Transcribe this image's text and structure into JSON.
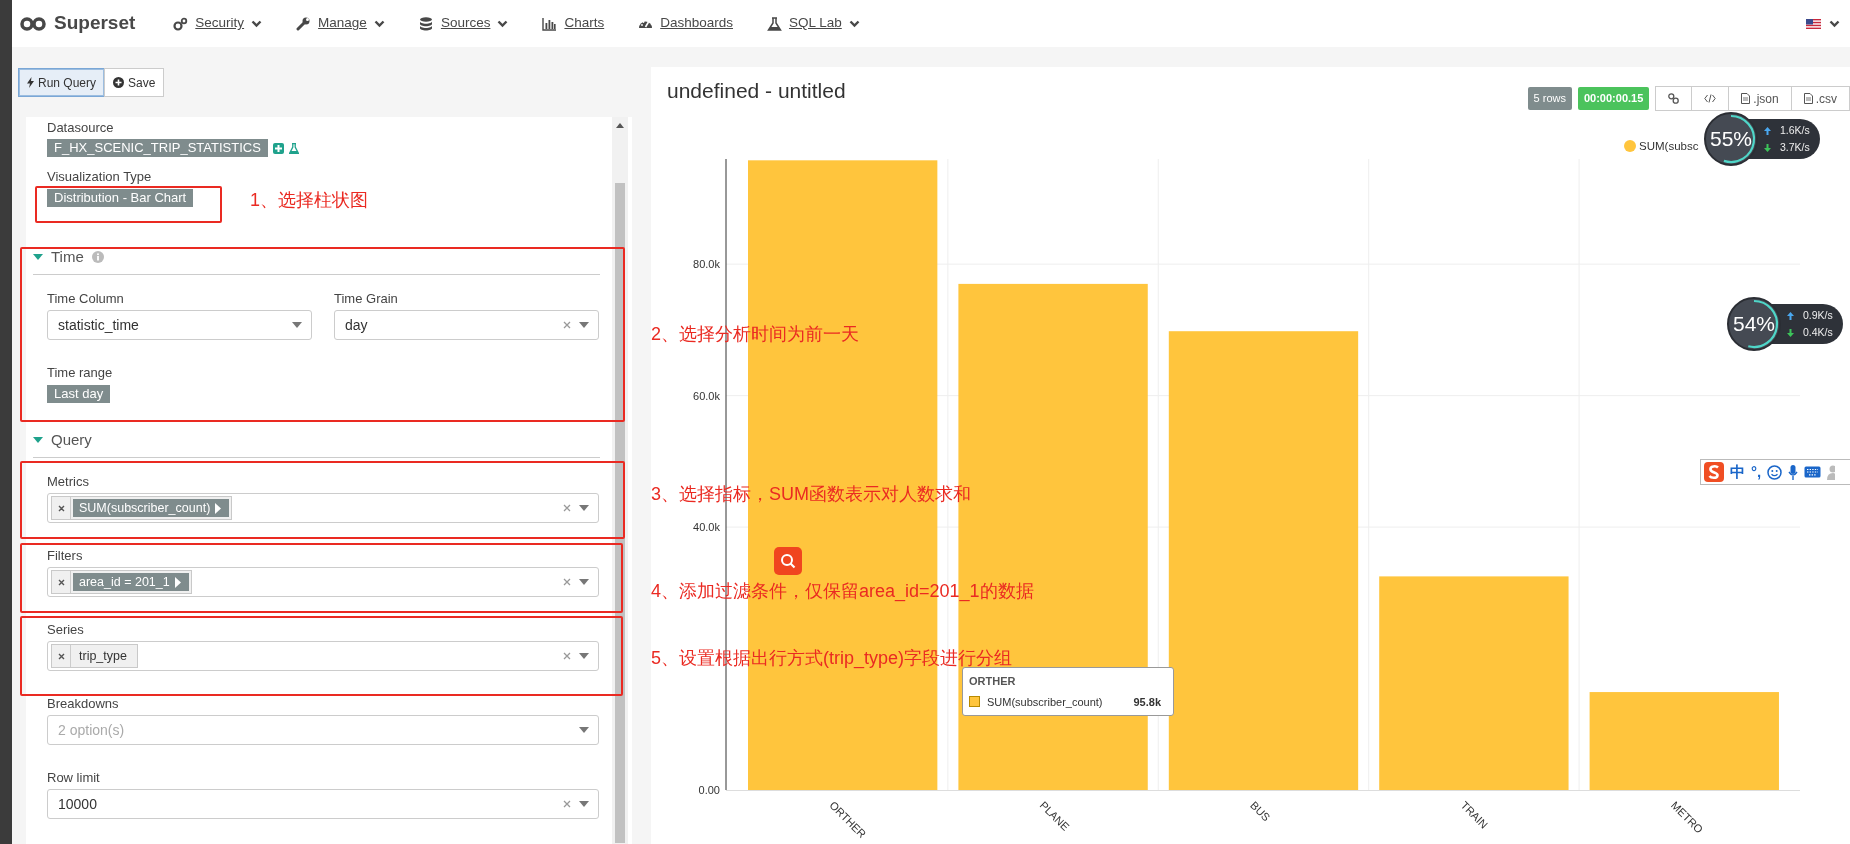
{
  "navbar": {
    "brand": "Superset",
    "items": [
      {
        "label": "Security",
        "dropdown": true
      },
      {
        "label": "Manage",
        "dropdown": true
      },
      {
        "label": "Sources",
        "dropdown": true
      },
      {
        "label": "Charts",
        "dropdown": false
      },
      {
        "label": "Dashboards",
        "dropdown": false
      },
      {
        "label": "SQL Lab",
        "dropdown": true
      }
    ],
    "language": {
      "dropdown": true
    }
  },
  "toolbar": {
    "buttons": [
      {
        "label": "Run Query",
        "focused": true
      },
      {
        "label": "Save",
        "focused": false
      }
    ]
  },
  "control_panel": {
    "datasource": {
      "label": "Datasource",
      "value": "F_HX_SCENIC_TRIP_STATISTICS"
    },
    "visualization_type": {
      "label": "Visualization Type",
      "value": "Distribution - Bar Chart"
    },
    "sections": [
      {
        "title": "Time",
        "expanded": true,
        "info": true,
        "rows": [
          [
            {
              "label": "Time Column",
              "kind": "select",
              "value": "statistic_time",
              "clearable": false
            },
            {
              "label": "Time Grain",
              "kind": "select",
              "value": "day",
              "clearable": true
            }
          ],
          [
            {
              "label": "Time range",
              "kind": "tag",
              "value": "Last day"
            }
          ]
        ]
      },
      {
        "title": "Query",
        "expanded": true,
        "info": false,
        "rows": [
          [
            {
              "label": "Metrics",
              "kind": "multi",
              "tags": [
                {
                  "text": "SUM(subscriber_count)",
                  "kind": "adhoc"
                }
              ],
              "clearable": true
            }
          ],
          [
            {
              "label": "Filters",
              "kind": "multi",
              "tags": [
                {
                  "text": "area_id = 201_1",
                  "kind": "adhoc"
                }
              ],
              "clearable": true
            }
          ],
          [
            {
              "label": "Series",
              "kind": "multi",
              "tags": [
                {
                  "text": "trip_type",
                  "kind": "column"
                }
              ],
              "clearable": true
            }
          ],
          [
            {
              "label": "Breakdowns",
              "kind": "select",
              "placeholder": "2 option(s)",
              "clearable": false
            }
          ],
          [
            {
              "label": "Row limit",
              "kind": "select",
              "value": "10000",
              "clearable": true
            }
          ]
        ]
      }
    ]
  },
  "chart_panel": {
    "title": "undefined - untitled",
    "row_count": "5 rows",
    "query_time": "00:00:00.15",
    "actions": [
      {
        "kind": "link"
      },
      {
        "kind": "code"
      },
      {
        "kind": "file",
        "label": ".json"
      },
      {
        "kind": "file",
        "label": ".csv"
      }
    ],
    "chart_data": {
      "type": "bar",
      "grid": true,
      "categories": [
        "ORTHER",
        "PLANE",
        "BUS",
        "TRAIN",
        "METRO"
      ],
      "series": [
        {
          "name": "SUM(subsc",
          "color": "#ffc53d",
          "values": [
            95800,
            77000,
            69800,
            32500,
            14900
          ]
        }
      ],
      "ylim": [
        0,
        96000
      ],
      "yticks": [
        {
          "value": 0,
          "label": "0.00"
        },
        {
          "value": 40000,
          "label": "40.0k"
        },
        {
          "value": 60000,
          "label": "60.0k"
        },
        {
          "value": 80000,
          "label": "80.0k"
        }
      ]
    },
    "tooltip": {
      "title": "ORTHER",
      "series": "SUM(subscriber_count)",
      "value": "95.8k",
      "color": "#ffc53d"
    }
  },
  "annotations": [
    {
      "text": "1、选择柱状图"
    },
    {
      "text": "2、选择分析时间为前一天"
    },
    {
      "text": "3、选择指标，SUM函数表示对人数求和"
    },
    {
      "text": "4、添加过滤条件，仅保留area_id=201_1的数据"
    },
    {
      "text": "5、设置根据出行方式(trip_type)字段进行分组"
    }
  ],
  "network_monitors": [
    {
      "percent": "55%",
      "level": 0.55,
      "upload": "1.6K/s",
      "download": "3.7K/s"
    },
    {
      "percent": "54%",
      "level": 0.54,
      "upload": "0.9K/s",
      "download": "0.4K/s"
    }
  ],
  "ime_toolbar": {
    "items": [
      "中",
      "°,"
    ]
  }
}
